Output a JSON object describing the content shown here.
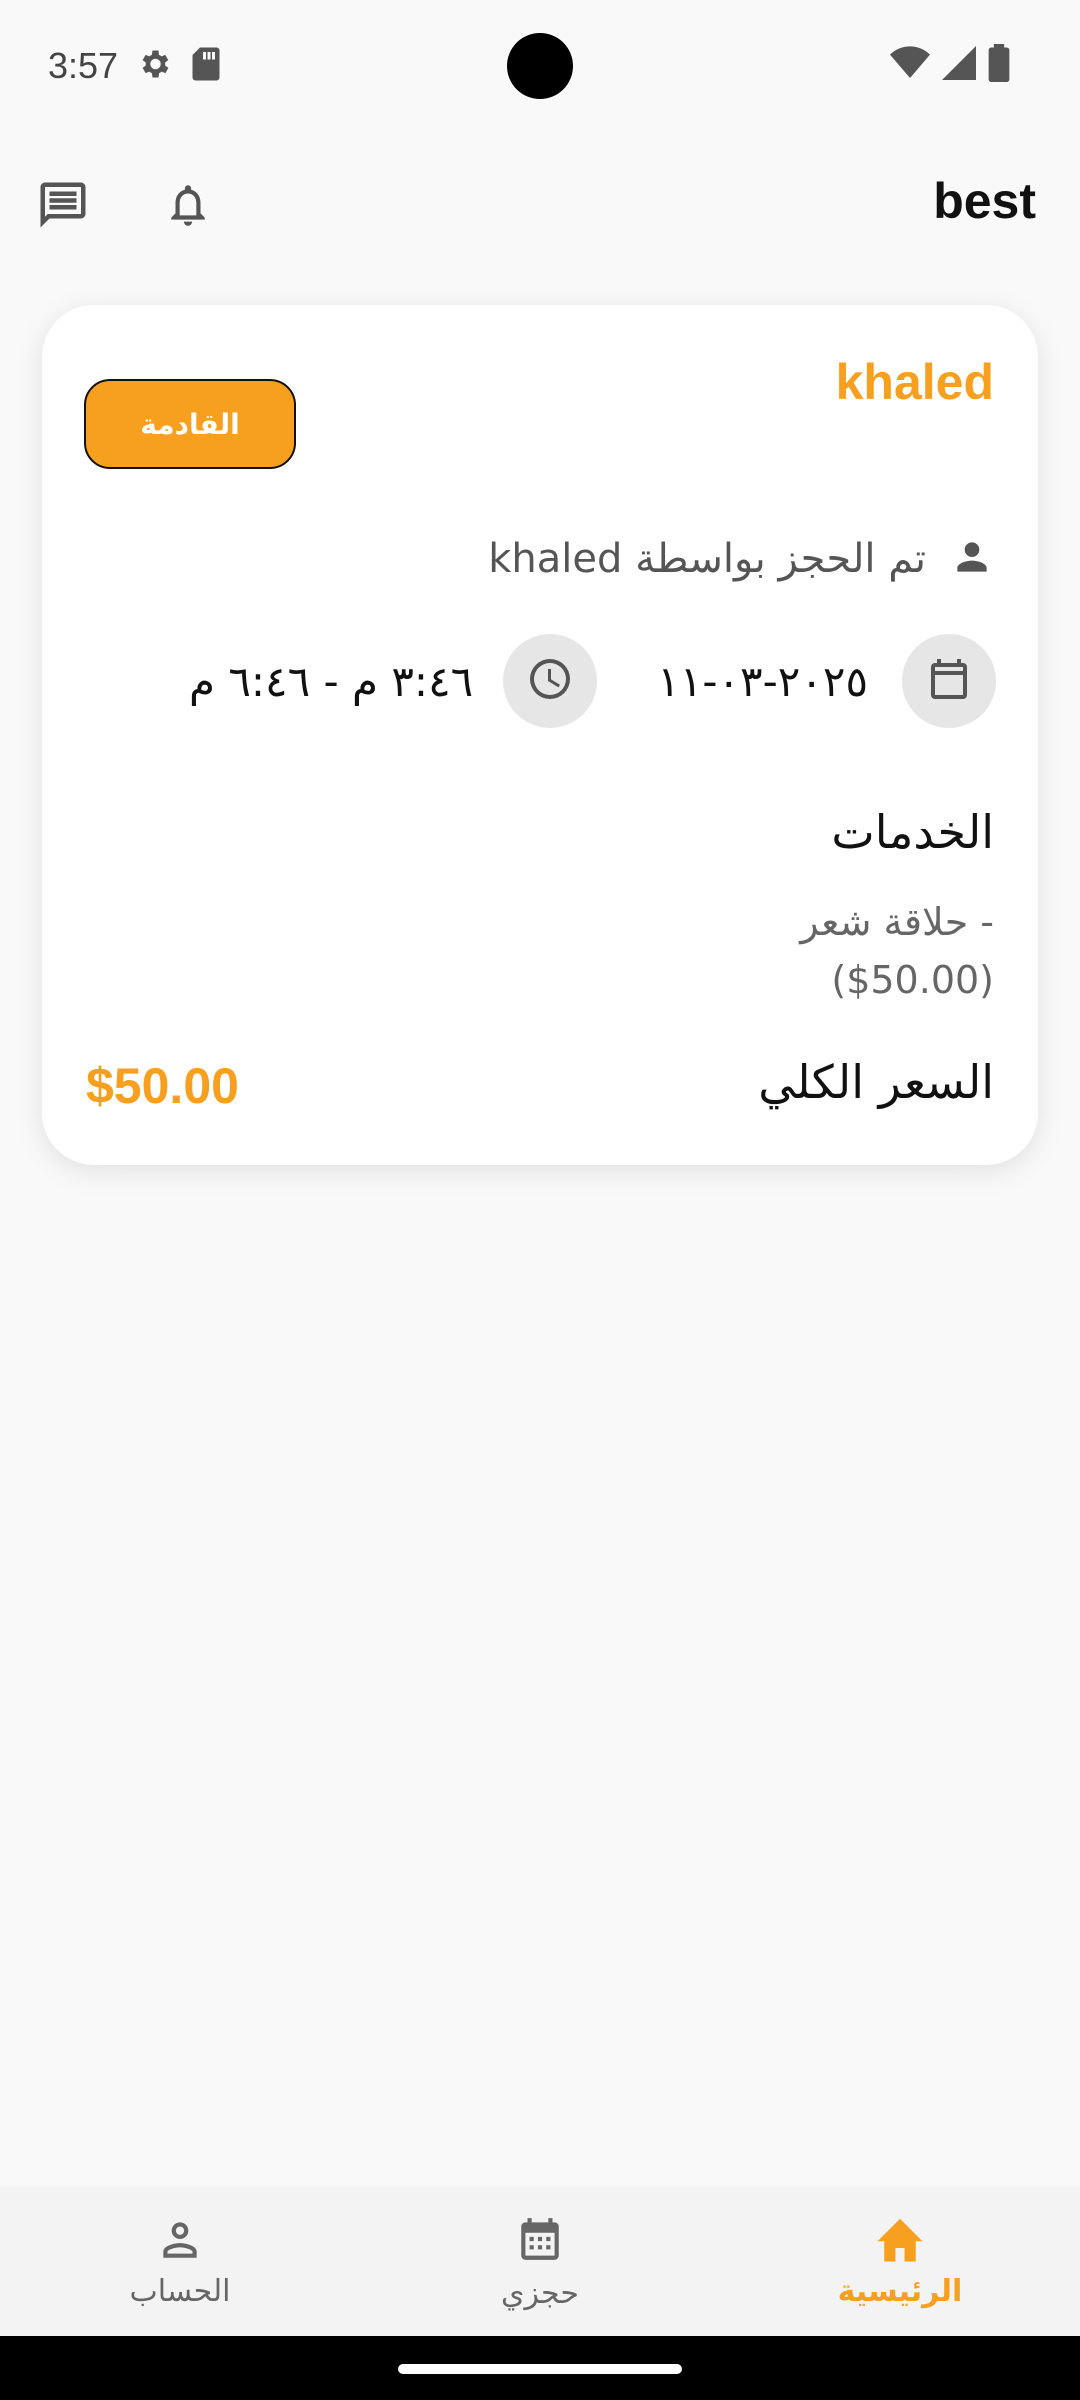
{
  "status_bar": {
    "time": "3:57"
  },
  "app_bar": {
    "title": "best"
  },
  "booking": {
    "customer_name": "khaled",
    "status_label": "القادمة",
    "booked_by": "تم الحجز بواسطة khaled",
    "date": "٢٠٢٥-٠٣-١١",
    "time_range": "٣:٤٦ م - ٦:٤٦ م",
    "services_title": "الخدمات",
    "services": [
      {
        "line1": "- حلاقة شعر",
        "line2": "($50.00)"
      }
    ],
    "total_label": "السعر الكلي",
    "total_value": "$50.00"
  },
  "bottom_nav": {
    "items": [
      {
        "label": "الحساب",
        "icon": "account-icon",
        "active": false
      },
      {
        "label": "حجزي",
        "icon": "calendar-icon",
        "active": false
      },
      {
        "label": "الرئيسية",
        "icon": "home-icon",
        "active": true
      }
    ]
  },
  "colors": {
    "accent": "#f7a020",
    "background": "#f9f9f9",
    "card": "#ffffff"
  }
}
